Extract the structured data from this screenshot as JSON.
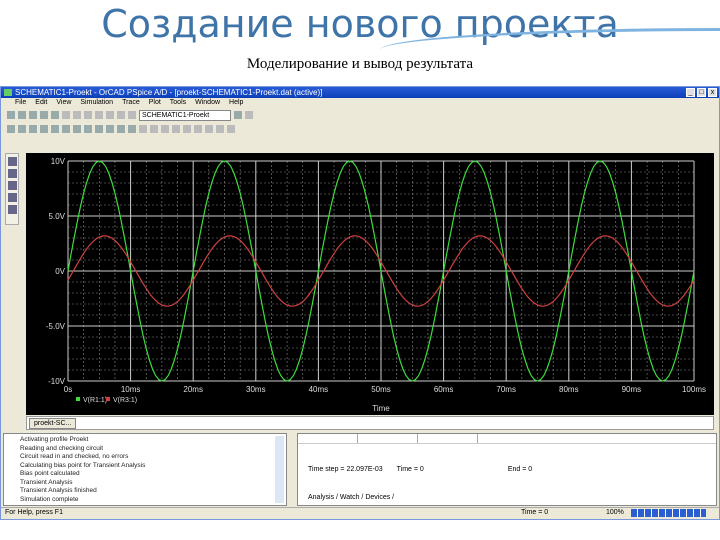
{
  "slide": {
    "title": "Создание нового проекта",
    "subtitle": "Моделирование и вывод результата"
  },
  "window": {
    "title": "SCHEMATIC1-Proekt - OrCAD PSpice A/D - [proekt-SCHEMATIC1-Proekt.dat (active)]",
    "menu": [
      "File",
      "Edit",
      "View",
      "Simulation",
      "Trace",
      "Plot",
      "Tools",
      "Window",
      "Help"
    ],
    "profile_select": "SCHEMATIC1-Proekt",
    "buttons": [
      "_",
      "□",
      "x"
    ]
  },
  "plot_tab": "proekt-SC...",
  "log": [
    "Activating profile Proekt",
    "Reading and checking circuit",
    "Circuit read in and checked, no errors",
    "Calculating bias point for Transient Analysis",
    "Bias point calculated",
    "Transient Analysis",
    "Transient Analysis finished",
    "Simulation complete"
  ],
  "output": {
    "timestep_label": "Time step = 22.097E-03",
    "time_label": "Time = 0",
    "end_label": "End = 0",
    "tabs": "Analysis / Watch / Devices /"
  },
  "status": {
    "left": "For Help, press F1",
    "mid": "Time = 0",
    "right": "100%"
  },
  "chart_data": {
    "type": "line",
    "xlabel": "Time",
    "xlim": [
      0,
      100
    ],
    "ylim": [
      -10,
      10
    ],
    "grid": true,
    "xticks": [
      "0s",
      "10ms",
      "20ms",
      "30ms",
      "40ms",
      "50ms",
      "60ms",
      "70ms",
      "80ms",
      "90ms",
      "100ms"
    ],
    "yticks": [
      "10V",
      "5.0V",
      "0V",
      "-5.0V",
      "-10V"
    ],
    "series": [
      {
        "name": "V(R1:1)",
        "color": "#3ddc3d",
        "amplitude": 10,
        "frequency_hz": 50,
        "phase_deg": 0
      },
      {
        "name": "V(R3:1)",
        "color": "#d04040",
        "amplitude": 3.2,
        "frequency_hz": 50,
        "phase_deg": -15
      }
    ]
  }
}
